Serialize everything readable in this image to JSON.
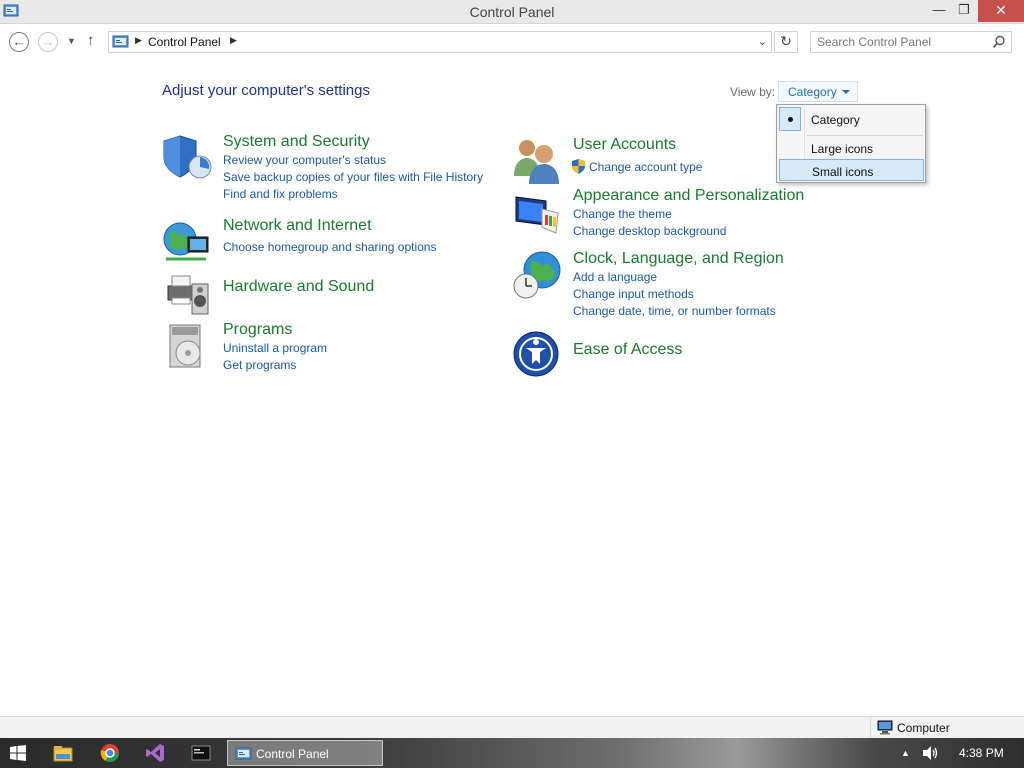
{
  "window": {
    "title": "Control Panel",
    "min_glyph": "—",
    "max_glyph": "❐",
    "close_glyph": "✕"
  },
  "address": {
    "crumb": "Control Panel",
    "search_placeholder": "Search Control Panel"
  },
  "main": {
    "heading": "Adjust your computer's settings",
    "view_by_label": "View by:",
    "view_by_value": "Category"
  },
  "view_menu": {
    "items": [
      "Category",
      "Large icons",
      "Small icons"
    ],
    "checked": "Category",
    "hovered": "Small icons"
  },
  "categories_left": [
    {
      "title": "System and Security",
      "icon": "shield-icon",
      "links": [
        "Review your computer's status",
        "Save backup copies of your files with File History",
        "Find and fix problems"
      ]
    },
    {
      "title": "Network and Internet",
      "icon": "network-globe-icon",
      "links": [
        "Choose homegroup and sharing options"
      ]
    },
    {
      "title": "Hardware and Sound",
      "icon": "printer-speaker-icon",
      "links": []
    },
    {
      "title": "Programs",
      "icon": "programs-disc-icon",
      "links": [
        "Uninstall a program",
        "Get programs"
      ]
    }
  ],
  "categories_right": [
    {
      "title": "User Accounts",
      "icon": "users-icon",
      "links": [
        "Change account type"
      ]
    },
    {
      "title": "Appearance and Personalization",
      "icon": "monitor-palette-icon",
      "links": [
        "Change the theme",
        "Change desktop background"
      ]
    },
    {
      "title": "Clock, Language, and Region",
      "icon": "clock-globe-icon",
      "links": [
        "Add a language",
        "Change input methods",
        "Change date, time, or number formats"
      ]
    },
    {
      "title": "Ease of Access",
      "icon": "ease-of-access-icon",
      "links": []
    }
  ],
  "status": {
    "location": "Computer"
  },
  "taskbar": {
    "active_window": "Control Panel",
    "time": "4:38 PM"
  },
  "colors": {
    "heading": "#1e3287",
    "category_title": "#1a7a2e",
    "link": "#1a5aa8",
    "close_button": "#c7514a"
  }
}
